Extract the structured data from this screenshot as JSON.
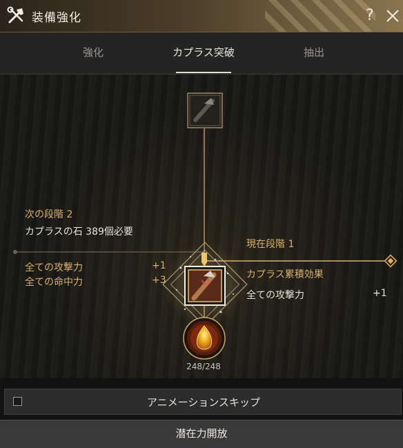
{
  "window": {
    "title": "装備強化",
    "help_label": "?"
  },
  "tabs": [
    {
      "label": "強化",
      "active": false
    },
    {
      "label": "カプラス突破",
      "active": true
    },
    {
      "label": "抽出",
      "active": false
    }
  ],
  "next_stage": {
    "title": "次の段階 2",
    "requirement": "カプラスの石 389個必要",
    "effects": [
      {
        "name": "全ての攻撃力",
        "value": "+1"
      },
      {
        "name": "全ての命中力",
        "value": "+3"
      }
    ]
  },
  "current_stage": {
    "title": "現在段階 1",
    "effect_header": "カプラス累積効果",
    "effects": [
      {
        "name": "全ての攻撃力",
        "value": "+1"
      }
    ]
  },
  "stone_count": "248/248",
  "skip_animation": {
    "label": "アニメーションスキップ",
    "checked": false
  },
  "release_button": "潜在力開放",
  "colors": {
    "gold": "#d9b06a",
    "accent_line": "#e0b060",
    "title_bar": "#4b3d28"
  }
}
